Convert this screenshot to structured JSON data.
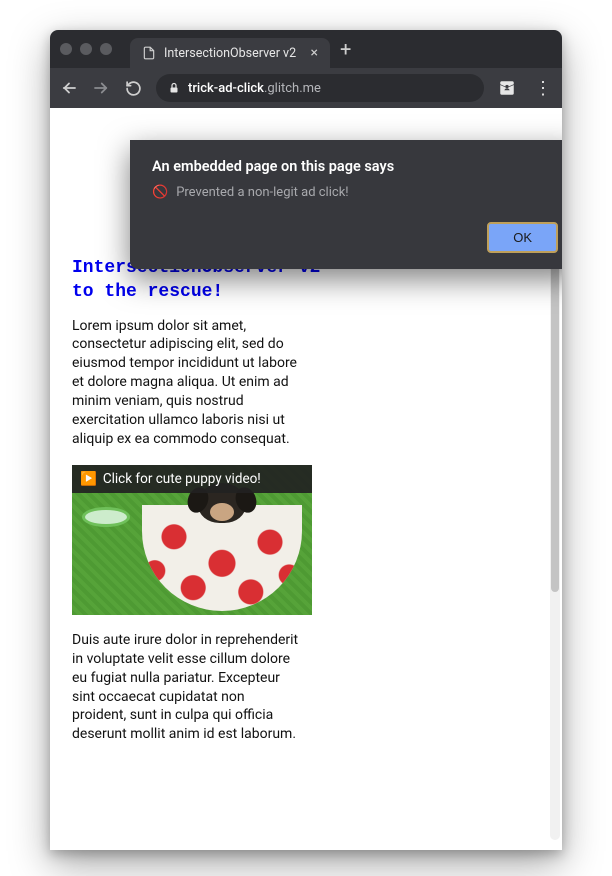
{
  "tab": {
    "title": "IntersectionObserver v2"
  },
  "address": {
    "host": "trick-ad-click",
    "domain": ".glitch.me"
  },
  "dialog": {
    "title": "An embedded page on this page says",
    "message": "Prevented a non-legit ad click!",
    "ok": "OK"
  },
  "page": {
    "heading_part1": "IntersectionObserver v2",
    "heading_part2": " to the rescue!",
    "para1": "Lorem ipsum dolor sit amet, consectetur adipiscing elit, sed do eiusmod tempor incididunt ut labore et dolore magna aliqua. Ut enim ad minim veniam, quis nostrud exercitation ullamco laboris nisi ut aliquip ex ea commodo consequat.",
    "ad_label": "Click for cute puppy video!",
    "para2": "Duis aute irure dolor in reprehenderit in voluptate velit esse cillum dolore eu fugiat nulla pariatur. Excepteur sint occaecat cupidatat non proident, sunt in culpa qui officia deserunt mollit anim id est laborum."
  }
}
